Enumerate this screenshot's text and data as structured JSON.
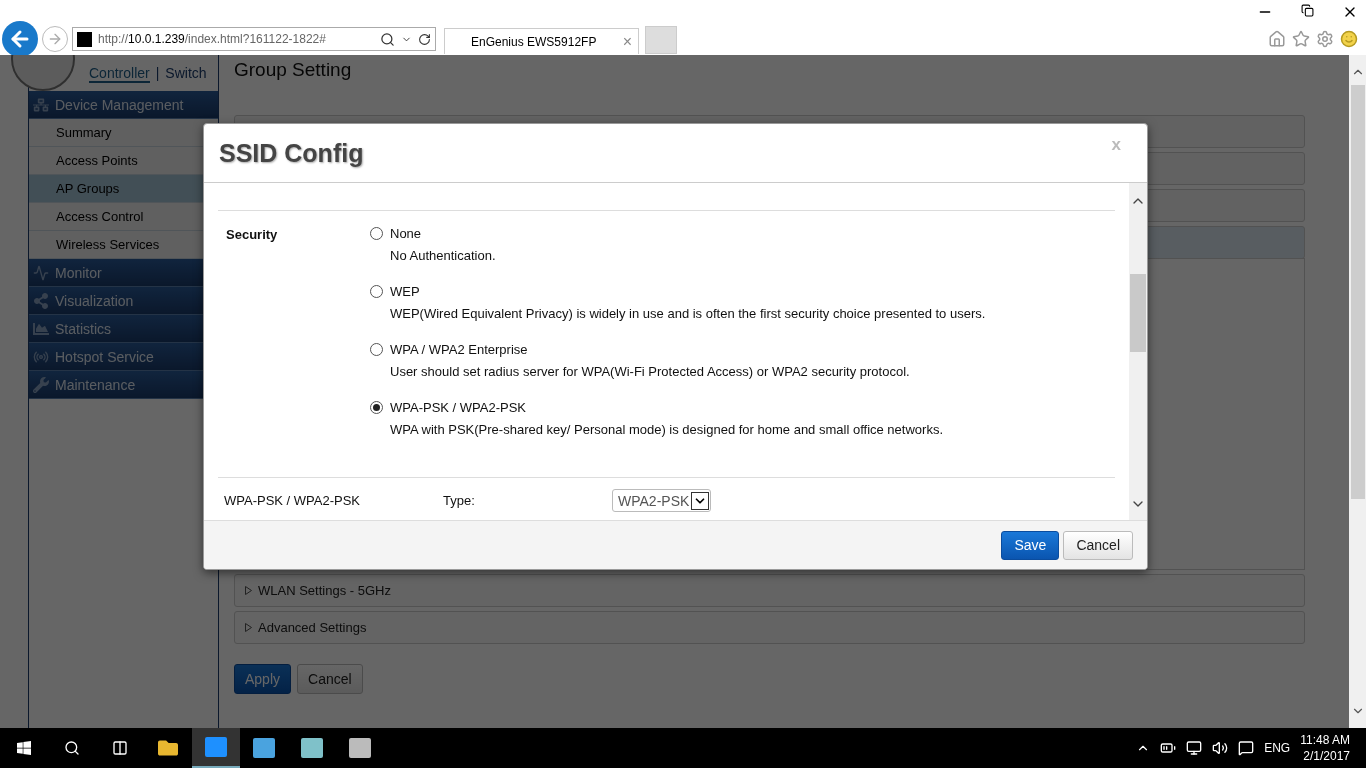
{
  "browser": {
    "url_prefix": "http://",
    "url_host": "10.0.1.239",
    "url_path": "/index.html?161122-1822#",
    "tab_title": "EnGenius EWS5912FP",
    "tab_close": "×"
  },
  "sidebar": {
    "links": [
      {
        "label": "Controller",
        "selected": true
      },
      {
        "label": "Switch",
        "selected": false
      }
    ],
    "separator": "|",
    "sections": [
      {
        "label": "Device Management",
        "items": [
          {
            "label": "Summary",
            "selected": false
          },
          {
            "label": "Access Points",
            "selected": false
          },
          {
            "label": "AP Groups",
            "selected": true
          },
          {
            "label": "Access Control",
            "selected": false
          },
          {
            "label": "Wireless Services",
            "selected": false
          }
        ]
      },
      {
        "label": "Monitor"
      },
      {
        "label": "Visualization"
      },
      {
        "label": "Statistics"
      },
      {
        "label": "Hotspot Service"
      },
      {
        "label": "Maintenance"
      }
    ]
  },
  "page": {
    "title": "Group Setting",
    "panels": [
      {
        "label": "WLAN Settings - 5GHz"
      },
      {
        "label": "Advanced Settings"
      }
    ],
    "buttons": [
      {
        "label": "Apply",
        "kind": "primary"
      },
      {
        "label": "Cancel",
        "kind": "secondary"
      }
    ]
  },
  "modal": {
    "title": "SSID Config",
    "close": "x",
    "security_label": "Security",
    "options": [
      {
        "label": "None",
        "description": "No Authentication.",
        "selected": false
      },
      {
        "label": "WEP",
        "description": "WEP(Wired Equivalent Privacy) is widely in use and is often the first security choice presented to users.",
        "selected": false
      },
      {
        "label": "WPA / WPA2 Enterprise",
        "description": "User should set radius server for WPA(Wi-Fi Protected Access) or WPA2 security protocol.",
        "selected": false
      },
      {
        "label": "WPA-PSK / WPA2-PSK",
        "description": "WPA with PSK(Pre-shared key/ Personal mode) is designed for home and small office networks.",
        "selected": true
      }
    ],
    "psk": {
      "label": "WPA-PSK / WPA2-PSK",
      "field_label": "Type:",
      "value": "WPA2-PSK"
    },
    "buttons": [
      {
        "label": "Save",
        "kind": "primary"
      },
      {
        "label": "Cancel",
        "kind": "secondary"
      }
    ]
  },
  "taskbar": {
    "apps": [
      {
        "selected": false
      },
      {
        "selected": true
      },
      {
        "selected": false
      },
      {
        "selected": false
      },
      {
        "selected": false
      }
    ],
    "language": "ENG",
    "time": "11:48 AM",
    "date": "2/1/2017"
  }
}
